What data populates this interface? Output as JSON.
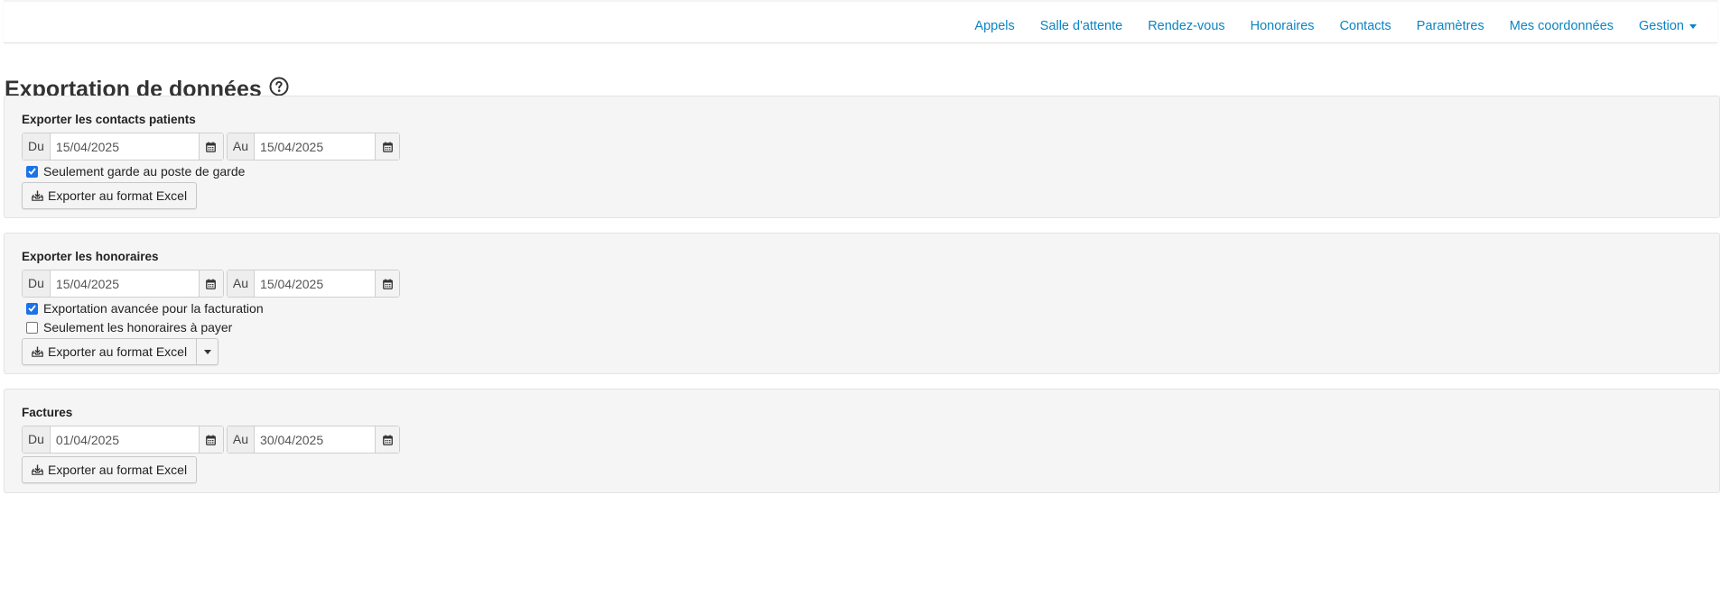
{
  "nav": {
    "items": [
      "Appels",
      "Salle d'attente",
      "Rendez-vous",
      "Honoraires",
      "Contacts",
      "Paramètres",
      "Mes coordonnées"
    ],
    "dropdown_label": "Gestion"
  },
  "page": {
    "title": "Exportation de données"
  },
  "sections": [
    {
      "title": "Exporter les contacts patients",
      "from_label": "Du",
      "from_value": "15/04/2025",
      "to_label": "Au",
      "to_value": "15/04/2025",
      "checkboxes": [
        {
          "label": "Seulement garde au poste de garde",
          "checked": true
        }
      ],
      "button_label": "Exporter au format Excel"
    },
    {
      "title": "Exporter les honoraires",
      "from_label": "Du",
      "from_value": "15/04/2025",
      "to_label": "Au",
      "to_value": "15/04/2025",
      "checkboxes": [
        {
          "label": "Exportation avancée pour la facturation",
          "checked": true
        },
        {
          "label": "Seulement les honoraires à payer",
          "checked": false
        }
      ],
      "button_label": "Exporter au format Excel"
    },
    {
      "title": "Factures",
      "from_label": "Du",
      "from_value": "01/04/2025",
      "to_label": "Au",
      "to_value": "30/04/2025",
      "checkboxes": [],
      "button_label": "Exporter au format Excel"
    }
  ],
  "colors": {
    "link": "#0c84c2",
    "checkbox_checked": "#1a73e8",
    "panel_bg": "#f5f5f5"
  }
}
